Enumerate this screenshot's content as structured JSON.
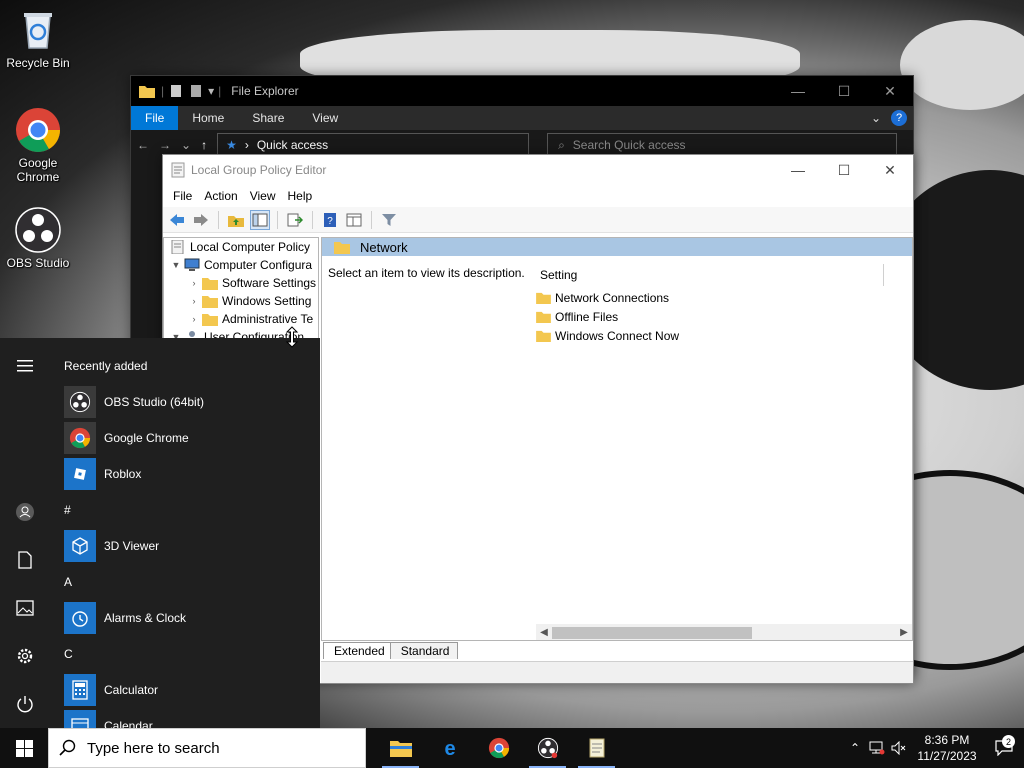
{
  "desktop": {
    "icons": [
      {
        "label": "Recycle Bin"
      },
      {
        "label": "Google Chrome"
      },
      {
        "label": "OBS Studio"
      }
    ]
  },
  "file_explorer": {
    "title": "File Explorer",
    "ribbon_tabs": [
      "File",
      "Home",
      "Share",
      "View"
    ],
    "address": "Quick access",
    "search_placeholder": "Search Quick access"
  },
  "gpe": {
    "title": "Local Group Policy Editor",
    "menu": [
      "File",
      "Action",
      "View",
      "Help"
    ],
    "tree": [
      {
        "label": "Local Computer Policy",
        "indent": 0,
        "expander": ""
      },
      {
        "label": "Computer Configura",
        "indent": 1,
        "expander": "▼"
      },
      {
        "label": "Software Settings",
        "indent": 2,
        "expander": "›"
      },
      {
        "label": "Windows Setting",
        "indent": 2,
        "expander": "›"
      },
      {
        "label": "Administrative Te",
        "indent": 2,
        "expander": "›"
      },
      {
        "label": "User Configuration",
        "indent": 1,
        "expander": "▼"
      }
    ],
    "detail_header": "Network",
    "description": "Select an item to view its description.",
    "column_header": "Setting",
    "items": [
      "Network Connections",
      "Offline Files",
      "Windows Connect Now"
    ],
    "tabs": [
      "Extended",
      "Standard"
    ]
  },
  "start_menu": {
    "recently_added_heading": "Recently added",
    "recent_apps": [
      {
        "label": "OBS Studio (64bit)",
        "icon": "obs-icon"
      },
      {
        "label": "Google Chrome",
        "icon": "chrome-icon"
      },
      {
        "label": "Roblox",
        "icon": "roblox-icon"
      }
    ],
    "groups": [
      {
        "letter": "#",
        "apps": [
          {
            "label": "3D Viewer",
            "icon": "3d-viewer-icon"
          }
        ]
      },
      {
        "letter": "A",
        "apps": [
          {
            "label": "Alarms & Clock",
            "icon": "alarm-clock-icon"
          }
        ]
      },
      {
        "letter": "C",
        "apps": [
          {
            "label": "Calculator",
            "icon": "calculator-icon"
          },
          {
            "label": "Calendar",
            "icon": "calendar-icon"
          }
        ]
      }
    ]
  },
  "taskbar": {
    "search_placeholder": "Type here to search",
    "time": "8:36 PM",
    "date": "11/27/2023",
    "notification_count": "2"
  },
  "colors": {
    "accent": "#0078d7",
    "selection": "#a9c6e3",
    "start_bg": "#1f1f1f",
    "tile_blue": "#1c74c9"
  }
}
